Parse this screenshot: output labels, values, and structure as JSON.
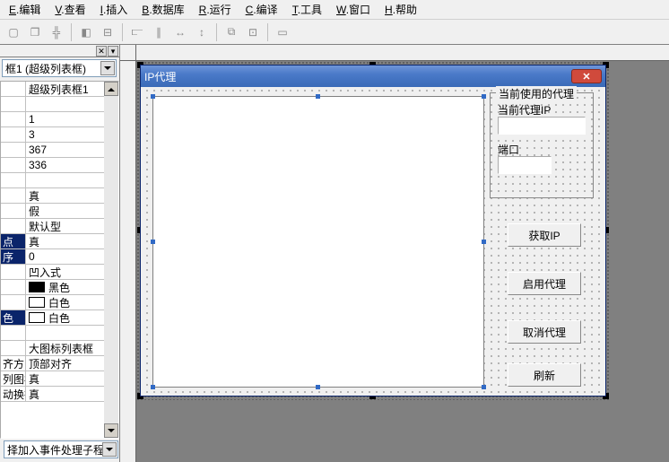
{
  "menu": {
    "edit": {
      "u": "E",
      "t": ".编辑"
    },
    "view": {
      "u": "V",
      "t": ".查看"
    },
    "insert": {
      "u": "I",
      "t": ".插入"
    },
    "db": {
      "u": "B",
      "t": ".数据库"
    },
    "run": {
      "u": "R",
      "t": ".运行"
    },
    "compile": {
      "u": "C",
      "t": ".编译"
    },
    "tools": {
      "u": "T",
      "t": ".工具"
    },
    "window": {
      "u": "W",
      "t": ".窗口"
    },
    "help": {
      "u": "H",
      "t": ".帮助"
    }
  },
  "left": {
    "object_combo": "框1 (超级列表框)",
    "events_combo": "择加入事件处理子程",
    "rows": [
      {
        "label": "",
        "value": "超级列表框1"
      },
      {
        "label": "",
        "value": ""
      },
      {
        "label": "",
        "value": "1"
      },
      {
        "label": "",
        "value": "3"
      },
      {
        "label": "",
        "value": "367"
      },
      {
        "label": "",
        "value": "336"
      },
      {
        "label": "",
        "value": ""
      },
      {
        "label": "",
        "value": "真"
      },
      {
        "label": "",
        "value": "假"
      },
      {
        "label": "",
        "value": "默认型"
      },
      {
        "label": "点",
        "value": "真",
        "sel": true,
        "dd": true
      },
      {
        "label": "序",
        "value": "0",
        "sel": true
      },
      {
        "label": "",
        "value": "凹入式"
      },
      {
        "label": "",
        "value": "黑色",
        "swatch": "#000000"
      },
      {
        "label": "",
        "value": "白色",
        "swatch": "#ffffff"
      },
      {
        "label": "色",
        "value": "白色",
        "swatch": "#ffffff",
        "sel": true
      },
      {
        "label": "",
        "value": ""
      },
      {
        "label": "",
        "value": "大图标列表框"
      },
      {
        "label": "齐方",
        "value": "顶部对齐"
      },
      {
        "label": "列图标",
        "value": "真"
      },
      {
        "label": "动换行",
        "value": "真"
      }
    ]
  },
  "form": {
    "title": "IP代理",
    "group_title": "当前使用的代理",
    "label_ip": "当前代理IP",
    "label_port": "端口",
    "value_ip": "",
    "value_port": "",
    "btn_get": "获取IP",
    "btn_enable": "启用代理",
    "btn_disable": "取消代理",
    "btn_refresh": "刷新"
  }
}
